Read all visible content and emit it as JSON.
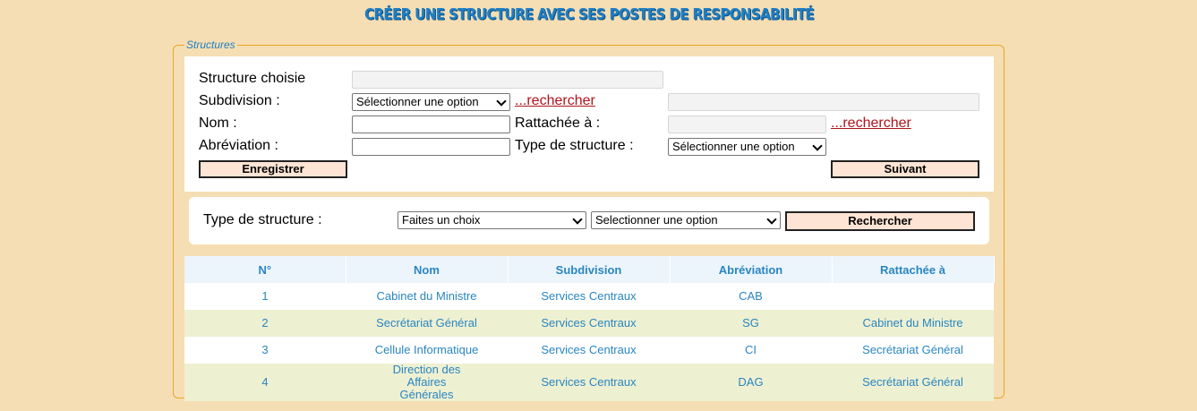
{
  "title": "CRÉER UNE STRUCTURE AVEC SES POSTES DE RESPONSABILITÉ",
  "fieldset_legend": "Structures",
  "form": {
    "structure_choisie_label": "Structure choisie",
    "structure_choisie_value": "",
    "subdivision_label": "Subdivision :",
    "subdivision_select": "Sélectionner une option",
    "subdivision_search_link": "...rechercher",
    "subdivision_value": "",
    "nom_label": "Nom :",
    "nom_value": "",
    "rattachee_label": "Rattachée à :",
    "rattachee_value": "",
    "rattachee_search_link": "...rechercher",
    "abreviation_label": "Abréviation :",
    "abreviation_value": "",
    "type_label": "Type de structure :",
    "type_select": "Sélectionner une option",
    "save_button": "Enregistrer",
    "next_button": "Suivant"
  },
  "search": {
    "type_label": "Type de structure :",
    "choice_select": "Faites un choix",
    "option_select": "Selectionner une option",
    "search_button": "Rechercher"
  },
  "table": {
    "headers": [
      "N°",
      "Nom",
      "Subdivision",
      "Abréviation",
      "Rattachée à"
    ],
    "rows": [
      {
        "num": "1",
        "nom": "Cabinet du Ministre",
        "subdivision": "Services Centraux",
        "abreviation": "CAB",
        "rattachee": ""
      },
      {
        "num": "2",
        "nom": "Secrétariat Général",
        "subdivision": "Services Centraux",
        "abreviation": "SG",
        "rattachee": "Cabinet du Ministre"
      },
      {
        "num": "3",
        "nom": "Cellule Informatique",
        "subdivision": "Services Centraux",
        "abreviation": "CI",
        "rattachee": "Secrétariat Général"
      },
      {
        "num": "4",
        "nom": "Direction des Affaires Générales",
        "subdivision": "Services Centraux",
        "abreviation": "DAG",
        "rattachee": "Secrétariat Général"
      }
    ]
  },
  "colors": {
    "background": "#f5deb3",
    "accent": "#1f7fc4",
    "link": "#b0141c",
    "button_bg": "#fde4d4"
  }
}
